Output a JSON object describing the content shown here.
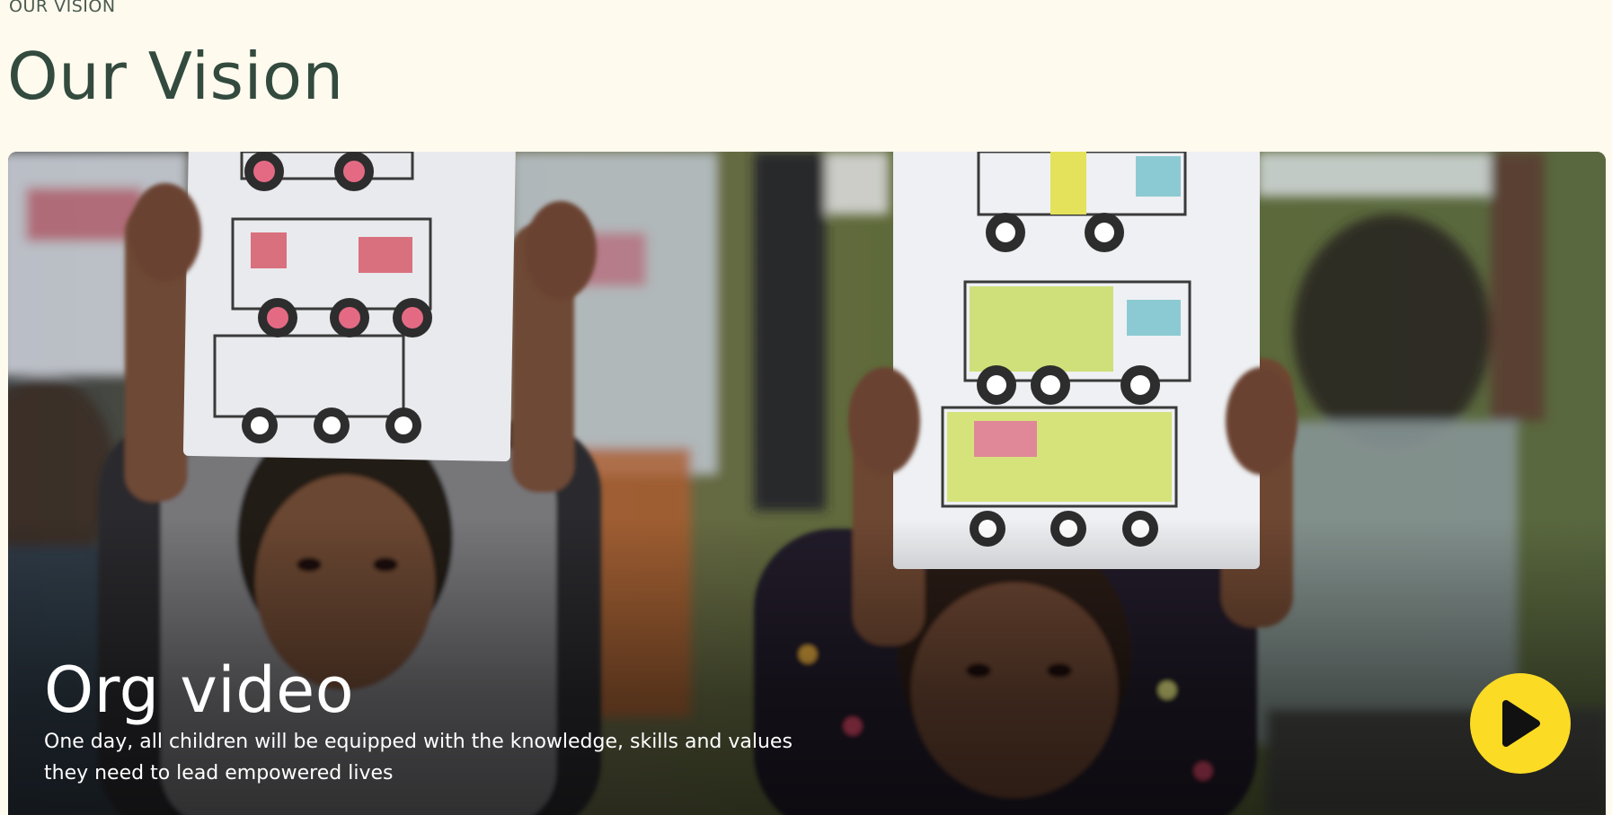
{
  "section": {
    "eyebrow": "OUR VISION",
    "title": "Our Vision"
  },
  "video": {
    "title": "Org video",
    "description": "One day, all children will be equipped with the knowledge, skills and values they need to lead empowered lives",
    "play_icon": "play-icon",
    "colors": {
      "play_button": "#fbdb24",
      "play_glyph": "#111111"
    }
  },
  "colors": {
    "page_background": "#fffaee",
    "heading": "#334a3e"
  }
}
